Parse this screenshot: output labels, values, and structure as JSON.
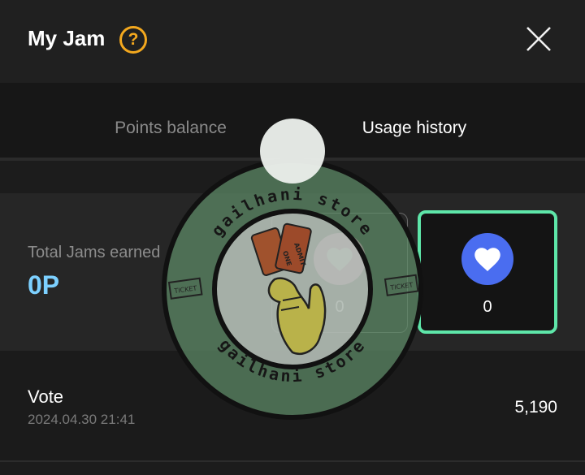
{
  "header": {
    "title": "My Jam",
    "help_icon": "question-circle-icon",
    "close_icon": "close-icon"
  },
  "tabs": [
    {
      "label": "Points balance",
      "active": false
    },
    {
      "label": "Usage history",
      "active": true
    }
  ],
  "summary": {
    "total_label": "Total Jams earned",
    "total_value": "0P",
    "cards": [
      {
        "icon": "heart-icon",
        "color": "#f08ac0",
        "count": "0"
      },
      {
        "icon": "heart-icon",
        "color": "#4a6df0",
        "count": "0"
      }
    ]
  },
  "history": [
    {
      "title": "Vote",
      "date": "2024.04.30 21:41",
      "amount": "5,190"
    }
  ],
  "watermark": {
    "text_top": "gailhani store",
    "text_bottom": "gailhani store",
    "ticket_left": "TICKET",
    "ticket_right": "TICKET",
    "ticket_center_1": "ADMIT",
    "ticket_center_2": "ONE"
  },
  "colors": {
    "accent_green": "#5ee6a9",
    "total_value": "#7cd0ff",
    "help": "#f3a81e"
  }
}
